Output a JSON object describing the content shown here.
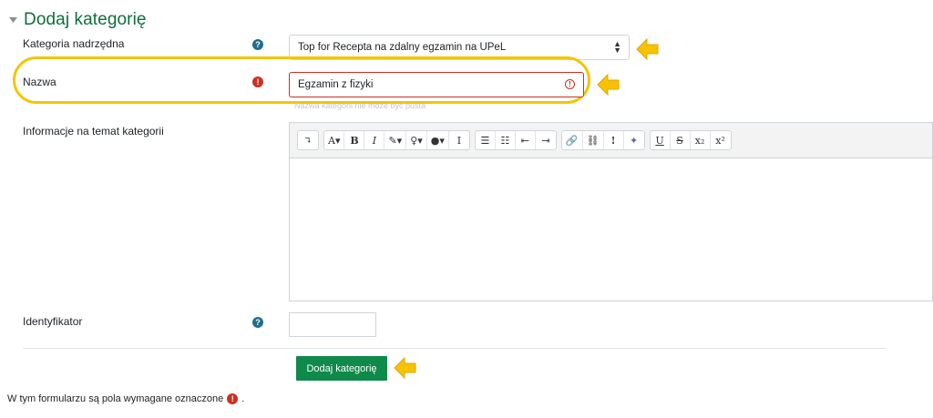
{
  "header": {
    "title": "Dodaj kategorię",
    "collapse_icon": "chevron-down-icon"
  },
  "fields": {
    "parent_category": {
      "label": "Kategoria nadrzędna",
      "value": "Top for Recepta na zdalny egzamin na UPeL",
      "help_icon": "question-circle-icon"
    },
    "name": {
      "label": "Nazwa",
      "value": "Egzamin z fizyki",
      "error": "Nazwa kategorii nie może być pusta",
      "required_icon": "exclamation-circle-icon"
    },
    "description": {
      "label": "Informacje na temat kategorii",
      "toolbar": [
        [
          "↴"
        ],
        [
          "A▾",
          "B",
          "I",
          "✎▾",
          "♀▾",
          "●▾",
          "I"
        ],
        [
          "☰",
          "☷",
          "⇤",
          "⇥"
        ],
        [
          "🔗",
          "⛓",
          "!",
          "✦"
        ],
        [
          "U",
          "S",
          "x₂",
          "x²"
        ]
      ]
    },
    "identifier": {
      "label": "Identyfikator",
      "value": "",
      "help_icon": "question-circle-icon"
    }
  },
  "submit": {
    "label": "Dodaj kategorię"
  },
  "footer": {
    "note": "W tym formularzu są pola wymagane oznaczone",
    "suffix": "."
  },
  "colors": {
    "accent_green": "#0f8a4a",
    "title_green": "#0f6e3a",
    "error_red": "#ca3120",
    "highlight_yellow": "#f3c500"
  }
}
